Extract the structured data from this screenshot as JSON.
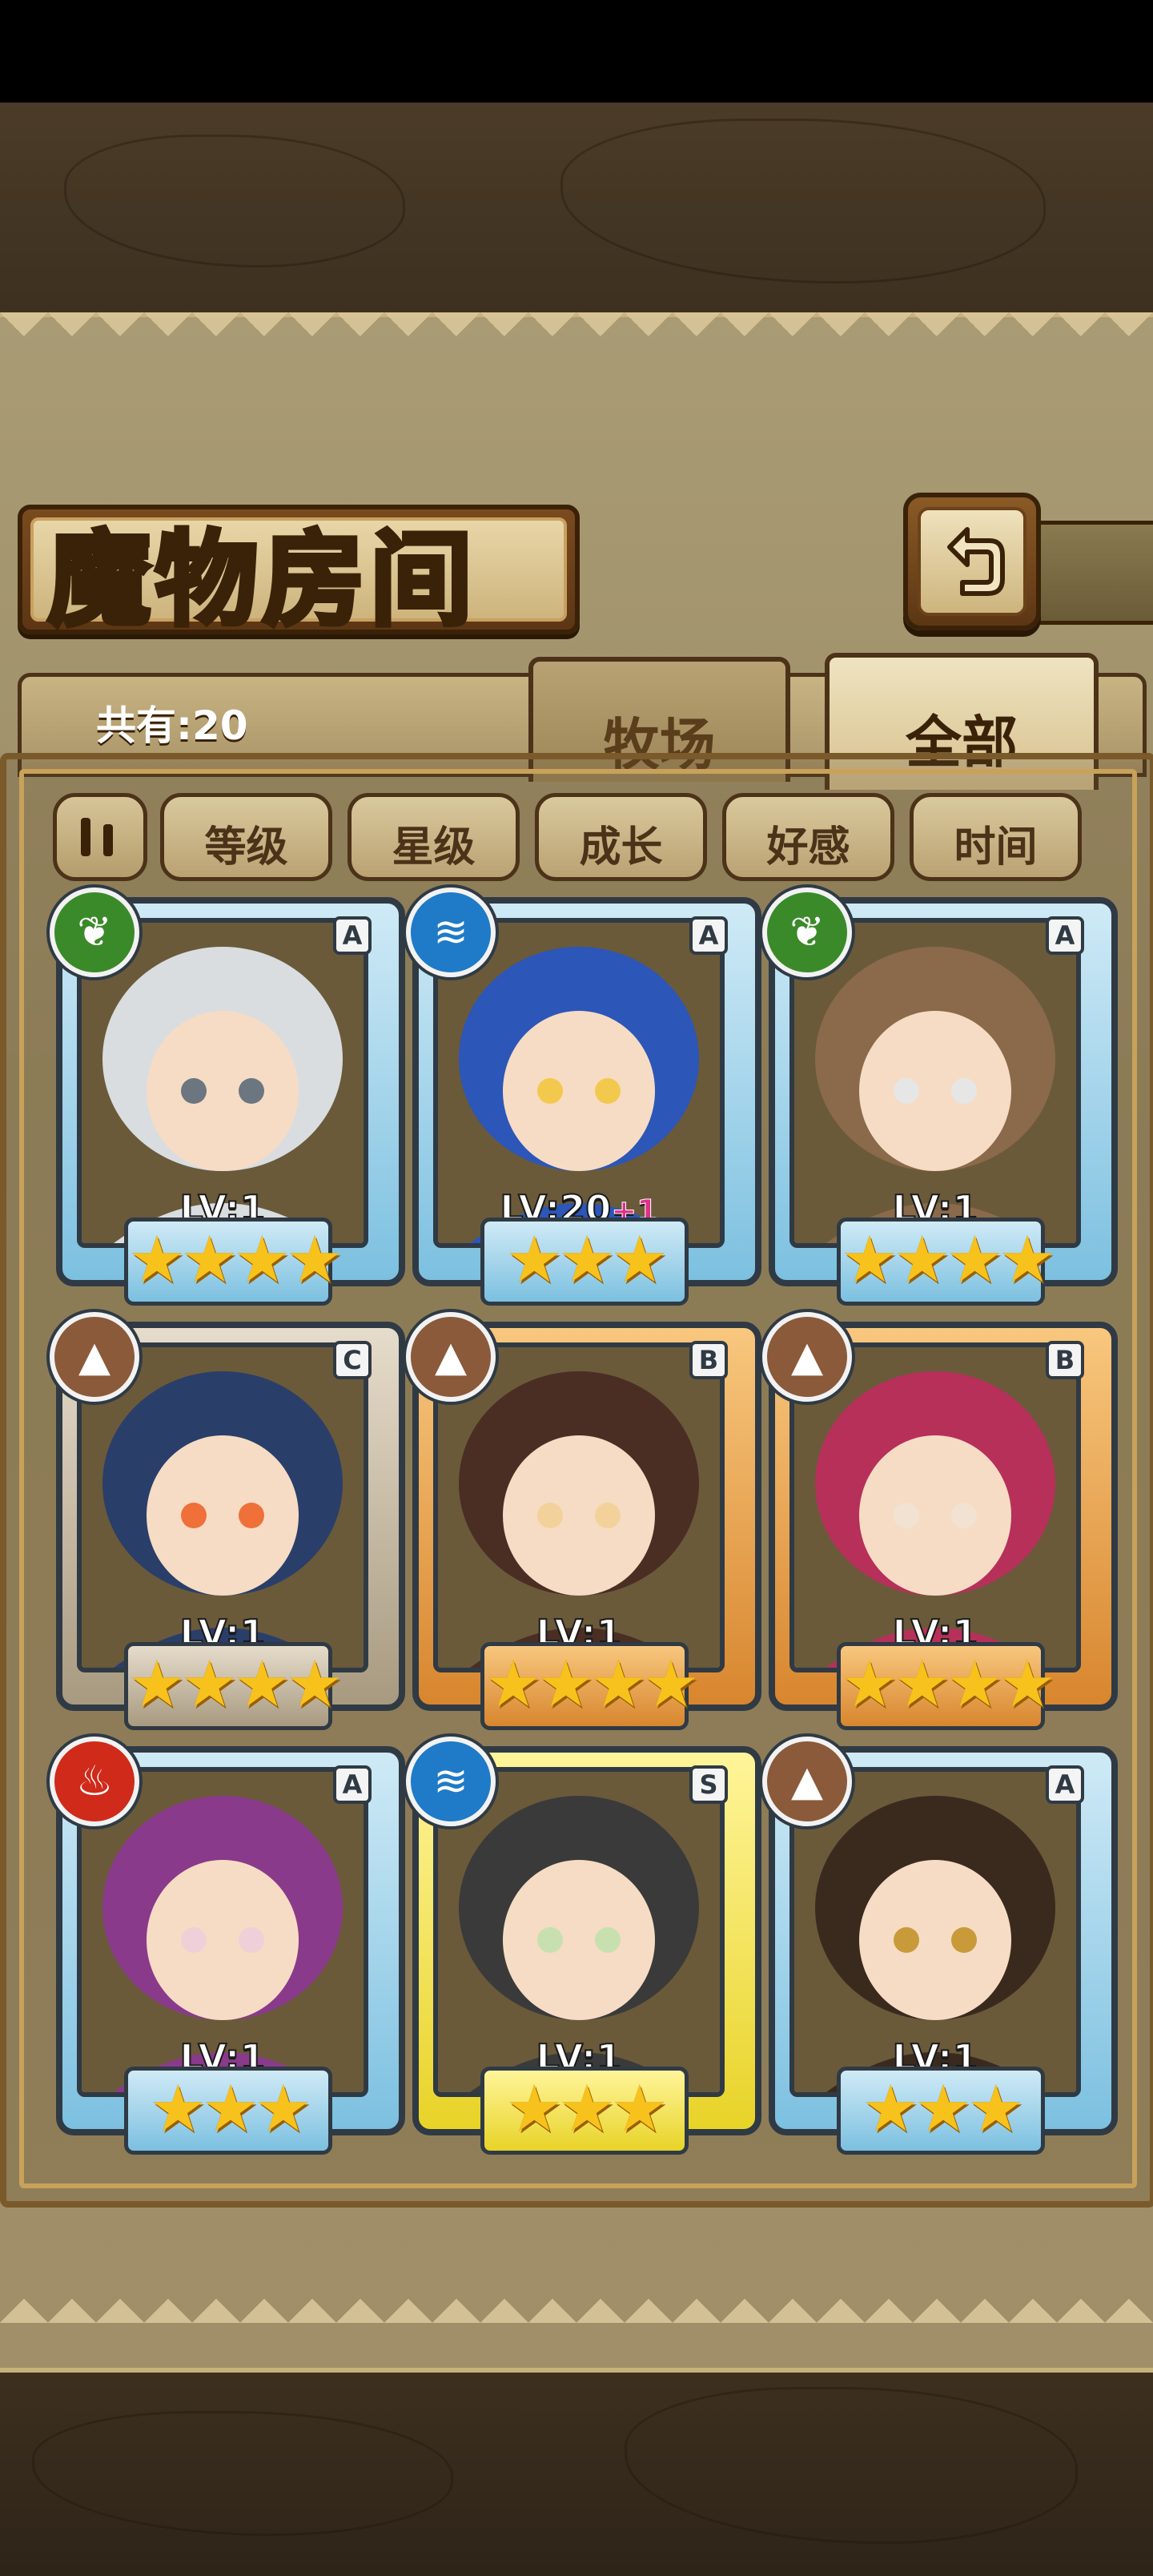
{
  "header": {
    "title": "魔物房间",
    "back_icon": "back-arrow-icon"
  },
  "tabs": {
    "count_label": "共有:20",
    "ranch": "牧场",
    "all": "全部",
    "active": "全部"
  },
  "sort": {
    "toggle_icon": "sort-toggle-icon",
    "buttons": [
      "等级",
      "星级",
      "成长",
      "好感",
      "时间"
    ]
  },
  "colors": {
    "grass": "#3a8a2a",
    "water": "#1f7ac8",
    "earth": "#8a5a3a",
    "fire": "#d02a1a",
    "rank_A": "#7cc0e0",
    "rank_B": "#d8862e",
    "rank_C": "#a89a80",
    "rank_S": "#e8d328",
    "star": "#f7c21c"
  },
  "monsters": [
    {
      "rank": "A",
      "element": "grass-icon",
      "level": "LV:1",
      "bonus": "",
      "stars": 4
    },
    {
      "rank": "A",
      "element": "water-icon",
      "level": "LV:20",
      "bonus": "+1",
      "stars": 3
    },
    {
      "rank": "A",
      "element": "grass-icon",
      "level": "LV:1",
      "bonus": "",
      "stars": 4
    },
    {
      "rank": "C",
      "element": "earth-icon",
      "level": "LV:1",
      "bonus": "",
      "stars": 4
    },
    {
      "rank": "B",
      "element": "earth-icon",
      "level": "LV:1",
      "bonus": "",
      "stars": 4
    },
    {
      "rank": "B",
      "element": "earth-icon",
      "level": "LV:1",
      "bonus": "",
      "stars": 4
    },
    {
      "rank": "A",
      "element": "fire-icon",
      "level": "LV:1",
      "bonus": "",
      "stars": 3
    },
    {
      "rank": "S",
      "element": "water-icon",
      "level": "LV:1",
      "bonus": "",
      "stars": 3
    },
    {
      "rank": "A",
      "element": "earth-icon",
      "level": "LV:1",
      "bonus": "",
      "stars": 3
    }
  ]
}
